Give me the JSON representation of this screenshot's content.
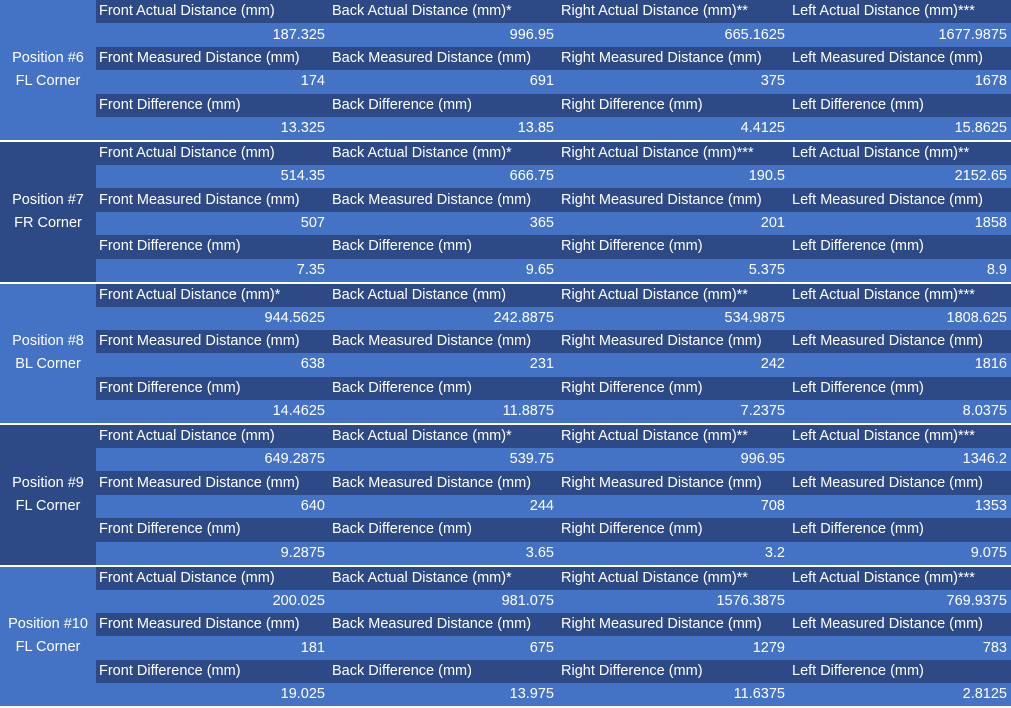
{
  "blocks": [
    {
      "position": "Position #6",
      "corner": "FL Corner",
      "rows": [
        {
          "labels": [
            "Front Actual Distance (mm)",
            "Back Actual Distance (mm)*",
            "Right Actual Distance (mm)**",
            "Left Actual Distance (mm)***"
          ],
          "values": [
            "187.325",
            "996.95",
            "665.1625",
            "1677.9875"
          ]
        },
        {
          "labels": [
            "Front Measured Distance (mm)",
            "Back Measured Distance (mm)",
            "Right Measured Distance (mm)",
            "Left Measured Distance (mm)"
          ],
          "values": [
            "174",
            "691",
            "375",
            "1678"
          ]
        },
        {
          "labels": [
            "Front Difference (mm)",
            "Back Difference (mm)",
            "Right Difference (mm)",
            "Left Difference (mm)"
          ],
          "values": [
            "13.325",
            "13.85",
            "4.4125",
            "15.8625"
          ]
        }
      ]
    },
    {
      "position": "Position #7",
      "corner": "FR Corner",
      "rows": [
        {
          "labels": [
            "Front Actual Distance (mm)",
            "Back Actual Distance (mm)*",
            "Right Actual Distance (mm)***",
            "Left Actual Distance (mm)**"
          ],
          "values": [
            "514.35",
            "666.75",
            "190.5",
            "2152.65"
          ]
        },
        {
          "labels": [
            "Front Measured Distance (mm)",
            "Back Measured Distance (mm)",
            "Right Measured Distance (mm)",
            "Left Measured Distance (mm)"
          ],
          "values": [
            "507",
            "365",
            "201",
            "1858"
          ]
        },
        {
          "labels": [
            "Front Difference (mm)",
            "Back Difference (mm)",
            "Right Difference (mm)",
            "Left Difference (mm)"
          ],
          "values": [
            "7.35",
            "9.65",
            "5.375",
            "8.9"
          ]
        }
      ]
    },
    {
      "position": "Position #8",
      "corner": "BL Corner",
      "rows": [
        {
          "labels": [
            "Front Actual Distance (mm)*",
            "Back Actual Distance (mm)",
            "Right Actual Distance (mm)**",
            "Left Actual Distance (mm)***"
          ],
          "values": [
            "944.5625",
            "242.8875",
            "534.9875",
            "1808.625"
          ]
        },
        {
          "labels": [
            "Front Measured Distance (mm)",
            "Back Measured Distance (mm)",
            "Right Measured Distance (mm)",
            "Left Measured Distance (mm)"
          ],
          "values": [
            "638",
            "231",
            "242",
            "1816"
          ]
        },
        {
          "labels": [
            "Front Difference (mm)",
            "Back Difference (mm)",
            "Right Difference (mm)",
            "Left Difference (mm)"
          ],
          "values": [
            "14.4625",
            "11.8875",
            "7.2375",
            "8.0375"
          ]
        }
      ]
    },
    {
      "position": "Position #9",
      "corner": "FL Corner",
      "rows": [
        {
          "labels": [
            "Front Actual Distance (mm)",
            "Back Actual Distance (mm)*",
            "Right Actual Distance (mm)**",
            "Left Actual Distance (mm)***"
          ],
          "values": [
            "649.2875",
            "539.75",
            "996.95",
            "1346.2"
          ]
        },
        {
          "labels": [
            "Front Measured Distance (mm)",
            "Back Measured Distance (mm)",
            "Right Measured Distance (mm)",
            "Left Measured Distance (mm)"
          ],
          "values": [
            "640",
            "244",
            "708",
            "1353"
          ]
        },
        {
          "labels": [
            "Front Difference (mm)",
            "Back Difference (mm)",
            "Right Difference (mm)",
            "Left Difference (mm)"
          ],
          "values": [
            "9.2875",
            "3.65",
            "3.2",
            "9.075"
          ]
        }
      ]
    },
    {
      "position": "Position #10",
      "corner": "FL Corner",
      "rows": [
        {
          "labels": [
            "Front Actual Distance (mm)",
            "Back Actual Distance (mm)*",
            "Right Actual Distance (mm)**",
            "Left Actual Distance (mm)***"
          ],
          "values": [
            "200.025",
            "981.075",
            "1576.3875",
            "769.9375"
          ]
        },
        {
          "labels": [
            "Front Measured Distance (mm)",
            "Back Measured Distance (mm)",
            "Right Measured Distance (mm)",
            "Left Measured Distance (mm)"
          ],
          "values": [
            "181",
            "675",
            "1279",
            "783"
          ]
        },
        {
          "labels": [
            "Front Difference (mm)",
            "Back Difference (mm)",
            "Right Difference (mm)",
            "Left Difference (mm)"
          ],
          "values": [
            "19.025",
            "13.975",
            "11.6375",
            "2.8125"
          ]
        }
      ]
    }
  ],
  "colors": {
    "label_row_bg": "#2e4a86",
    "value_row_bg": "#4472c4",
    "text": "#ffffff"
  }
}
